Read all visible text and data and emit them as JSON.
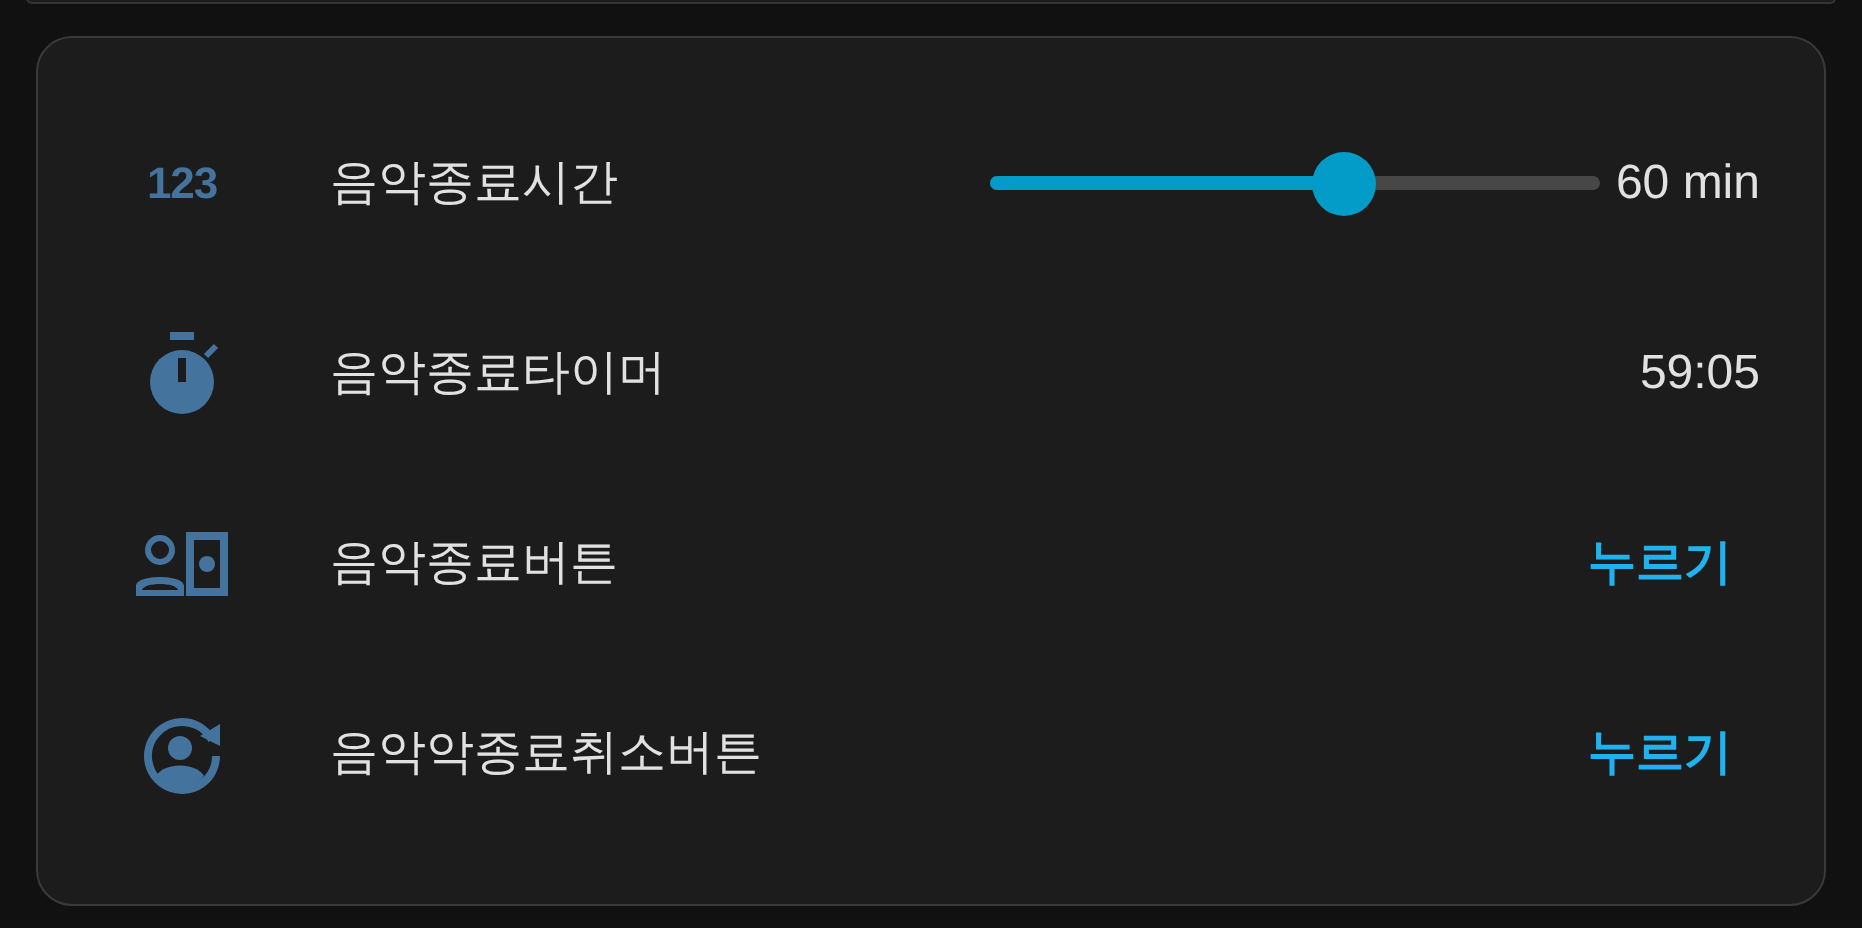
{
  "rows": [
    {
      "kind": "slider",
      "icon_text": "123",
      "label": "음악종료시간",
      "level": 0.58,
      "reading": "60 min"
    },
    {
      "kind": "value",
      "label": "음악종료타이머",
      "value": "59:05"
    },
    {
      "kind": "button",
      "label": "음악종료버튼",
      "action": "누르기"
    },
    {
      "kind": "button",
      "label": "음악악종료취소버튼",
      "action": "누르기"
    }
  ]
}
